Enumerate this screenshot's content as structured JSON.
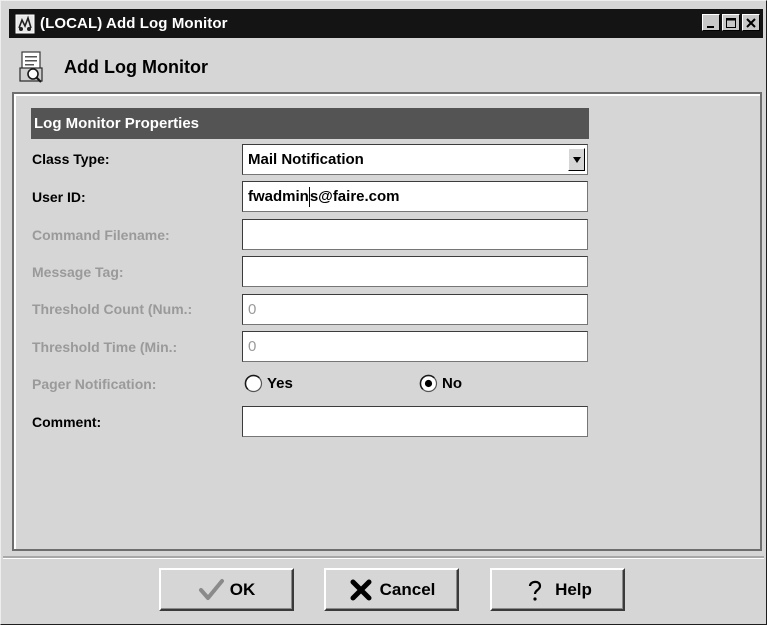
{
  "window": {
    "title": "(LOCAL) Add Log Monitor",
    "system_icon": "app-icon",
    "controls": [
      "minimize-icon",
      "maximize-icon",
      "close-icon"
    ]
  },
  "header": {
    "icon": "log-monitor-icon",
    "title": "Add Log Monitor"
  },
  "panel": {
    "section_title": "Log Monitor Properties"
  },
  "form": {
    "class_type": {
      "label": "Class Type:",
      "value": "Mail Notification",
      "enabled": true
    },
    "user_id": {
      "label": "User ID:",
      "value_before_caret": "fwadmin",
      "value_after_caret": "s@faire.com",
      "enabled": true
    },
    "command_filename": {
      "label": "Command Filename:",
      "value": "",
      "enabled": false
    },
    "message_tag": {
      "label": "Message Tag:",
      "value": "",
      "enabled": false
    },
    "threshold_count": {
      "label": "Threshold Count (Num.:",
      "value": "0",
      "enabled": false
    },
    "threshold_time": {
      "label": "Threshold Time (Min.:",
      "value": "0",
      "enabled": false
    },
    "pager_notification": {
      "label": "Pager Notification:",
      "enabled": false,
      "options": [
        {
          "label": "Yes",
          "selected": false
        },
        {
          "label": "No",
          "selected": true
        }
      ]
    },
    "comment": {
      "label": "Comment:",
      "value": "",
      "enabled": true
    }
  },
  "buttons": {
    "ok": {
      "label": "OK",
      "icon": "checkmark-icon"
    },
    "cancel": {
      "label": "Cancel",
      "icon": "x-icon"
    },
    "help": {
      "label": "Help",
      "icon": "question-mark-icon"
    }
  },
  "colors": {
    "title_bar": "#141414",
    "section_header": "#545454",
    "background": "#d6d6d6",
    "disabled_text": "#9a9a9a"
  }
}
